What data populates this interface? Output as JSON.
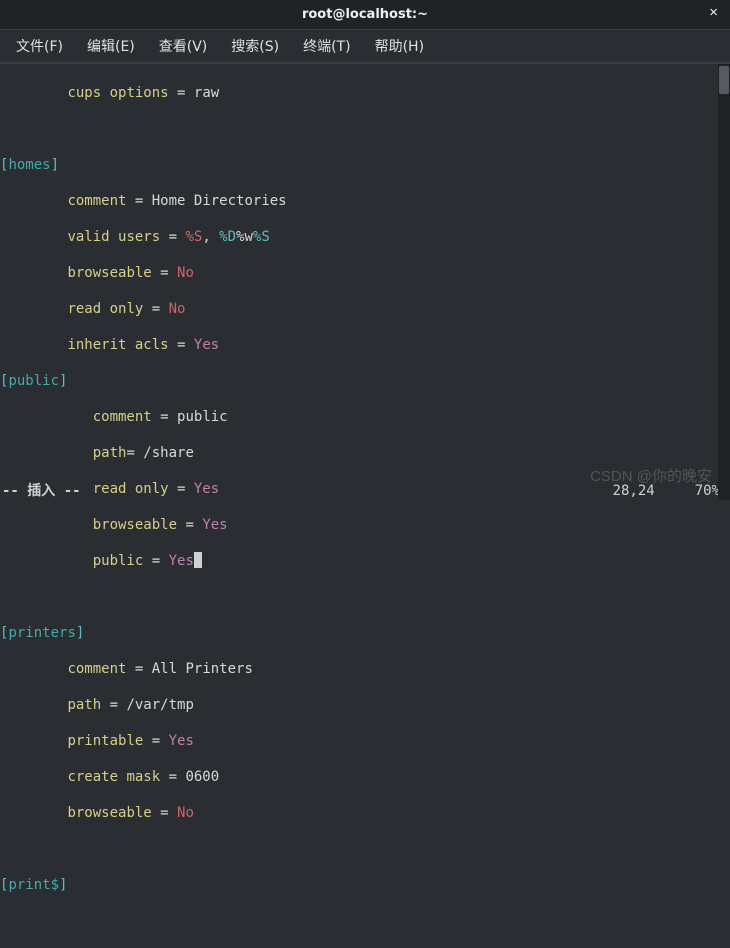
{
  "title": "root@localhost:~",
  "close_glyph": "×",
  "menu": [
    {
      "label": "文件(F)"
    },
    {
      "label": "编辑(E)"
    },
    {
      "label": "查看(V)"
    },
    {
      "label": "搜索(S)"
    },
    {
      "label": "终端(T)"
    },
    {
      "label": "帮助(H)"
    }
  ],
  "file": {
    "top": {
      "cups_key": "cups options",
      "cups_op": " = ",
      "cups_val": "raw"
    },
    "homes": {
      "section_open": "[",
      "section_name": "homes",
      "section_close": "]",
      "comment_key": "comment",
      "comment_op": " = ",
      "comment_val": "Home Directories",
      "valid_key": "valid users",
      "valid_op": " = ",
      "valid_v1": "%S",
      "valid_sep": ", ",
      "valid_v2a": "%D",
      "valid_v2b": "%w",
      "valid_v2c": "%S",
      "browse_key": "browseable",
      "browse_op": " = ",
      "browse_val": "No",
      "ro_key": "read only",
      "ro_op": " = ",
      "ro_val": "No",
      "acl_key": "inherit acls",
      "acl_op": " = ",
      "acl_val": "Yes"
    },
    "public": {
      "section_open": "[",
      "section_name": "public",
      "section_close": "]",
      "comment_key": "comment",
      "comment_op": " = ",
      "comment_val": "public",
      "path_key": "path",
      "path_op": "= ",
      "path_val": "/share",
      "ro_key": "read only",
      "ro_op": " = ",
      "ro_val": "Yes",
      "browse_key": "browseable",
      "browse_op": " = ",
      "browse_val": "Yes",
      "pub_key": "public",
      "pub_op": " = ",
      "pub_val": "Yes"
    },
    "printers": {
      "section_open": "[",
      "section_name": "printers",
      "section_close": "]",
      "comment_key": "comment",
      "comment_op": " = ",
      "comment_val": "All Printers",
      "path_key": "path",
      "path_op": " = ",
      "path_val": "/var/tmp",
      "print_key": "printable",
      "print_op": " = ",
      "print_val": "Yes",
      "mask_key": "create mask",
      "mask_op": " = ",
      "mask_val": "0600",
      "browse_key": "browseable",
      "browse_op": " = ",
      "browse_val": "No"
    },
    "printdollar": {
      "section_open": "[",
      "section_name": "print$",
      "section_close": "]"
    }
  },
  "status": {
    "mode": "-- 插入 --",
    "position": "28,24",
    "percent": "70%"
  },
  "watermark": "CSDN @你的晚安"
}
